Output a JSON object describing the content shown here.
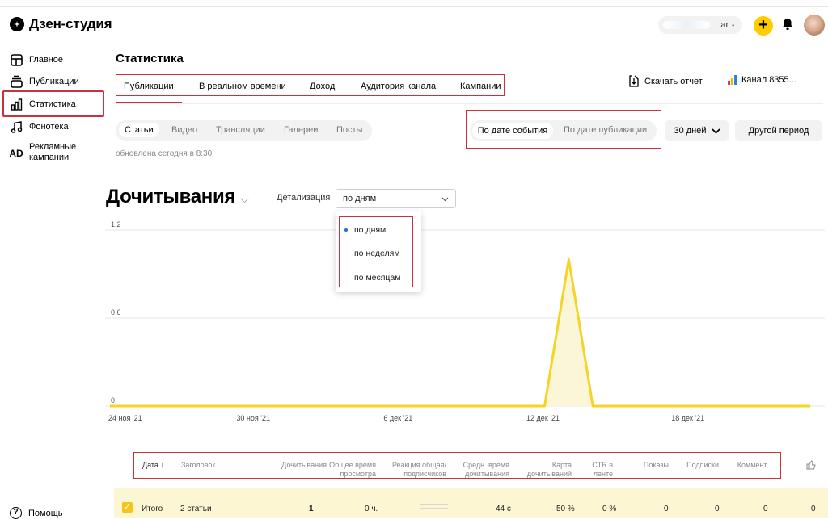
{
  "app": {
    "logo_text": "Дзен-студия"
  },
  "header": {
    "user_name": "ar",
    "plus_label": "+"
  },
  "sidebar": {
    "items": [
      {
        "label": "Главное",
        "icon": "layout-icon"
      },
      {
        "label": "Публикации",
        "icon": "publications-icon"
      },
      {
        "label": "Статистика",
        "icon": "chart-icon",
        "active": true
      },
      {
        "label": "Фонотека",
        "icon": "music-icon"
      },
      {
        "label": "Рекламные кампании",
        "icon": "ad-icon",
        "icon_text": "AD"
      }
    ],
    "help_label": "Помощь"
  },
  "page": {
    "title": "Статистика",
    "tabs": [
      "Публикации",
      "В реальном времени",
      "Доход",
      "Аудитория канала",
      "Кампании"
    ],
    "active_tab": "Публикации",
    "download_label": "Скачать отчет",
    "channel_label": "Канал 8355..."
  },
  "filters": {
    "content_types": [
      "Статьи",
      "Видео",
      "Трансляции",
      "Галереи",
      "Посты"
    ],
    "active_type": "Статьи",
    "updated_text": "обновлена сегодня в 8:30",
    "date_modes": [
      "По дате события",
      "По дате публикации"
    ],
    "active_date_mode": "По дате события",
    "period_label": "30 дней",
    "other_period_label": "Другой период"
  },
  "metric": {
    "title": "Дочитывания",
    "detail_label": "Детализация",
    "detail_value": "по дням",
    "detail_options": [
      "по дням",
      "по неделям",
      "по месяцам"
    ]
  },
  "colors": {
    "accent": "#c9323a",
    "chart_line": "#f5d327",
    "chart_fill": "#fcf6d9",
    "highlight_row": "#fdf6d3"
  },
  "chart_data": {
    "type": "area",
    "title": "",
    "xlabel": "",
    "ylabel": "",
    "yticks": [
      "1.2",
      "0.6",
      "0"
    ],
    "ylim": [
      0,
      1.2
    ],
    "xticks": [
      "24 ноя '21",
      "30 ноя '21",
      "6 дек '21",
      "12 дек '21",
      "18 дек '21"
    ],
    "x": [
      "24 ноя '21",
      "25 ноя '21",
      "26 ноя '21",
      "27 ноя '21",
      "28 ноя '21",
      "29 ноя '21",
      "30 ноя '21",
      "1 дек '21",
      "2 дек '21",
      "3 дек '21",
      "4 дек '21",
      "5 дек '21",
      "6 дек '21",
      "7 дек '21",
      "8 дек '21",
      "9 дек '21",
      "10 дек '21",
      "11 дек '21",
      "12 дек '21",
      "13 дек '21",
      "14 дек '21",
      "15 дек '21",
      "16 дек '21",
      "17 дек '21",
      "18 дек '21",
      "19 дек '21",
      "20 дек '21",
      "21 дек '21",
      "22 дек '21",
      "23 дек '21"
    ],
    "series": [
      {
        "values": [
          0,
          0,
          0,
          0,
          0,
          0,
          0,
          0,
          0,
          0,
          0,
          0,
          0,
          0,
          0,
          0,
          0,
          0,
          0,
          1,
          0,
          0,
          0,
          0,
          0,
          0,
          0,
          0,
          0,
          0
        ]
      }
    ],
    "grid": true
  },
  "table": {
    "headers": [
      "Дата",
      "Заголовок",
      "Дочитывания",
      "Общее время просмотра",
      "Реакция общая/ подписчиков",
      "Средн. время дочитывания",
      "Карта дочитываний",
      "CTR в ленте",
      "Показы",
      "Подписки",
      "Коммент."
    ],
    "sort_arrow": "↓",
    "total_row": {
      "label": "Итого",
      "title": "2 статьи",
      "reads": "1",
      "total_time": "0 ч.",
      "avg_time": "44 с",
      "read_map": "50 %",
      "ctr": "0 %",
      "views": "0",
      "subs": "0",
      "comments": "0",
      "likes": "0"
    }
  }
}
